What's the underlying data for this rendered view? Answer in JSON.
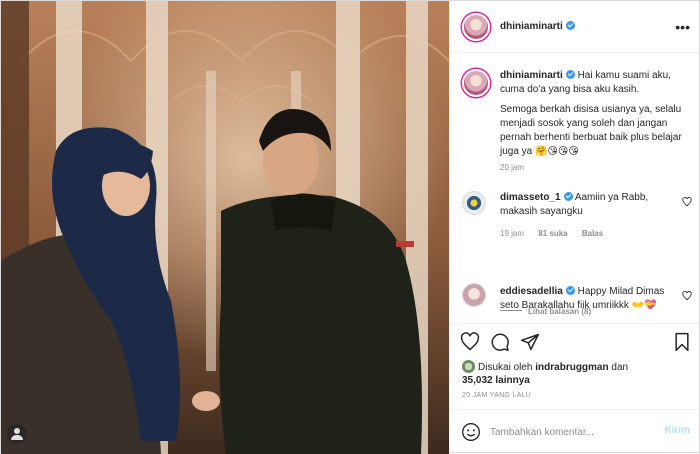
{
  "header": {
    "username": "dhiniaminarti",
    "more_icon": "ellipsis-icon"
  },
  "caption": {
    "username": "dhiniaminarti",
    "text1": "Hai kamu suami aku, cuma do'a yang bisa aku kasih.",
    "text2": "Semoga berkah disisa usianya ya, selalu menjadi sosok yang soleh dan jangan pernah berhenti berbuat baik plus belajar juga ya 🤗😘😘😘",
    "time": "20 jam"
  },
  "comments": [
    {
      "username": "dimasseto_1",
      "text": "Aamiin ya Rabb, makasih sayangku",
      "time": "19 jam",
      "likes": "81 suka",
      "reply": "Balas"
    },
    {
      "username": "eddiesadellia",
      "text": "Happy Milad Dimas seto Barakallahu fiik umriikkk 👐💝"
    }
  ],
  "replies": "Lihat balasan (8)",
  "likes": {
    "prefix": "Disukai oleh",
    "user": "indrabruggman",
    "and": "dan",
    "count": "35,032 lainnya"
  },
  "post_time": "20 JAM YANG LALU",
  "add_comment": {
    "placeholder": "Tambahkan komentar...",
    "post_label": "Kirim"
  },
  "colors": {
    "verified": "#3897f0",
    "post_button": "#b2dffc",
    "secondary_text": "#8e8e8e"
  }
}
